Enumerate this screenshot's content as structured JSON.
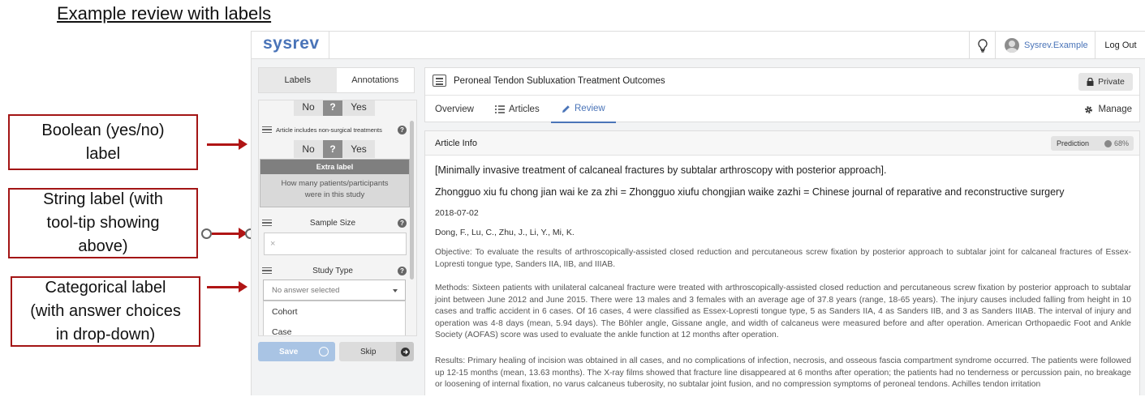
{
  "heading": "Example review with labels",
  "callouts": {
    "boolean": [
      "Boolean (yes/no)",
      "label"
    ],
    "string": [
      "String label (with",
      "tool-tip showing",
      "above)"
    ],
    "categorical": [
      "Categorical label",
      "(with answer choices",
      "in drop-down)"
    ]
  },
  "topbar": {
    "brand": "sysrev",
    "user": "Sysrev.Example",
    "logout": "Log Out"
  },
  "left": {
    "tabs": [
      "Labels",
      "Annotations"
    ],
    "yn": {
      "no": "No",
      "q": "?",
      "yes": "Yes"
    },
    "label_nonsurgical": "Article includes non-surgical treatments",
    "extra_header": "Extra label",
    "extra_line1": "How many patients/participants",
    "extra_line2": "were in this study",
    "label_sample_size": "Sample Size",
    "clear_x": "×",
    "label_study_type": "Study Type",
    "select_placeholder": "No answer selected",
    "options": [
      "Cohort",
      "Case"
    ],
    "save": "Save",
    "skip": "Skip"
  },
  "project": {
    "title": "Peroneal Tendon Subluxation Treatment Outcomes",
    "private": "Private",
    "nav": [
      "Overview",
      "Articles",
      "Review"
    ],
    "manage": "Manage"
  },
  "article": {
    "section": "Article Info",
    "prediction": "Prediction",
    "prediction_pct": "68%",
    "title": "[Minimally invasive treatment of calcaneal fractures by subtalar arthroscopy with posterior approach].",
    "journal": "Zhongguo xiu fu chong jian wai ke za zhi = Zhongguo xiufu chongjian waike zazhi = Chinese journal of reparative and reconstructive surgery",
    "date": "2018-07-02",
    "authors": "Dong, F., Lu, C., Zhu, J., Li, Y., Mi, K.",
    "objective": "Objective: To evaluate the results of arthroscopically-assisted closed reduction and percutaneous screw fixation by posterior approach to subtalar joint for calcaneal fractures of Essex-Lopresti tongue type, Sanders IIA, IIB, and IIIAB.",
    "methods": "Methods: Sixteen patients with unilateral calcaneal fracture were treated with arthroscopically-assisted closed reduction and percutaneous screw fixation by posterior approach to subtalar joint between June 2012 and June 2015. There were 13 males and 3 females with an average age of 37.8 years (range, 18-65 years). The injury causes included falling from height in 10 cases and traffic accident in 6 cases. Of 16 cases, 4 were classified as Essex-Lopresti tongue type, 5 as Sanders IIA, 4 as Sanders IIB, and 3 as Sanders IIIAB. The interval of injury and operation was 4-8 days (mean, 5.94 days). The Böhler angle, Gissane angle, and width of calcaneus were measured before and after operation. American Orthopaedic Foot and Ankle Society (AOFAS) score was used to evaluate the ankle function at 12 months after operation.",
    "results": "Results: Primary healing of incision was obtained in all cases, and no complications of infection, necrosis, and osseous fascia compartment syndrome occurred. The patients were followed up 12-15 months (mean, 13.63 months). The X-ray films showed that fracture line disappeared at 6 months after operation; the patients had no tenderness or percussion pain, no breakage or loosening of internal fixation, no varus calcaneus tuberosity, no subtalar joint fusion, and no compression symptoms of peroneal tendons. Achilles tendon irritation"
  }
}
